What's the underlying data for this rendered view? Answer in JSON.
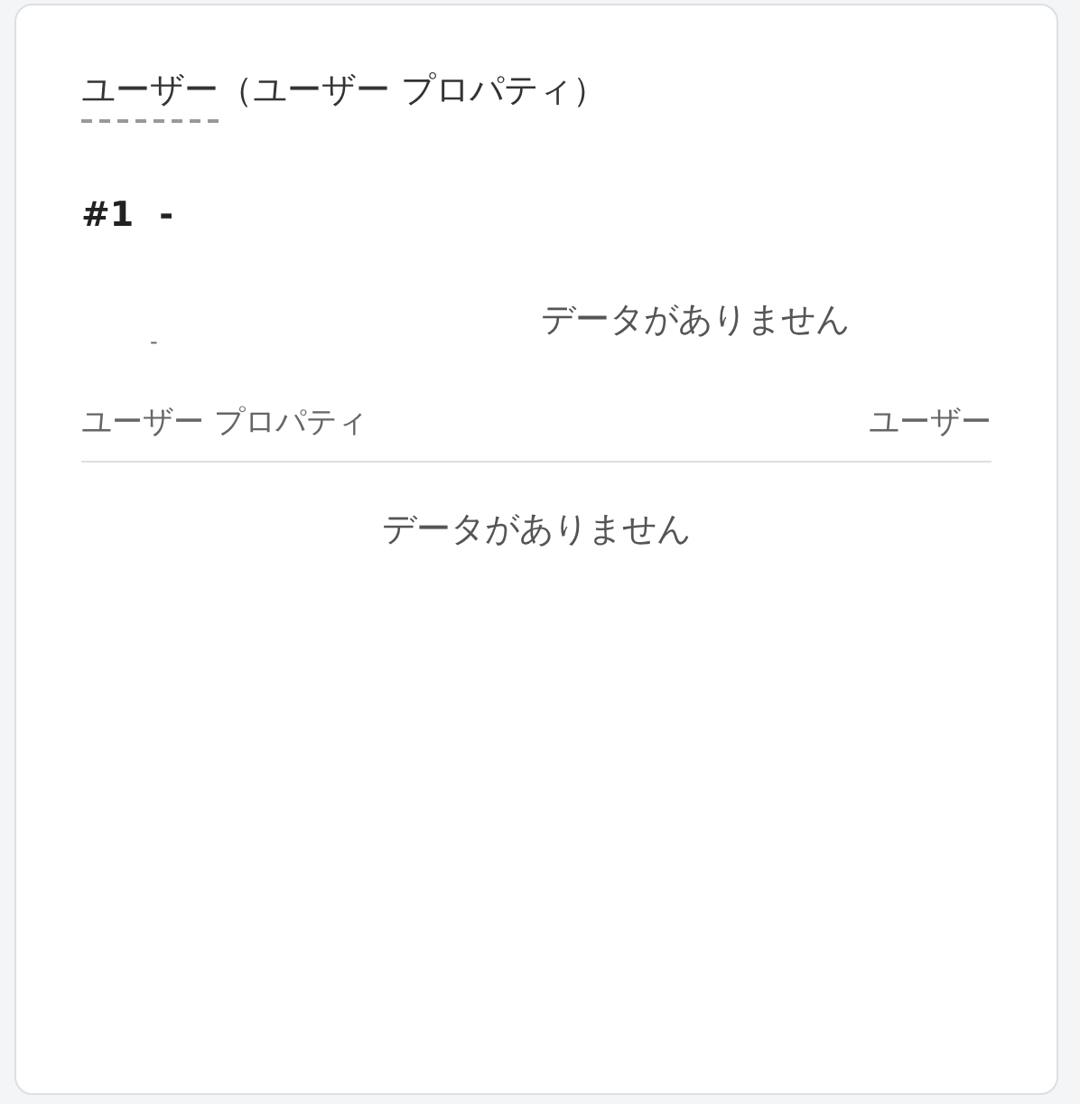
{
  "title": {
    "term": "ユーザー",
    "suffix": "（ユーザー プロパティ）"
  },
  "record": {
    "number": "#1",
    "name": "-"
  },
  "summary": {
    "value": "-",
    "empty": "データがありません"
  },
  "table": {
    "columns": [
      "ユーザー プロパティ",
      "ユーザー"
    ],
    "empty": "データがありません"
  }
}
